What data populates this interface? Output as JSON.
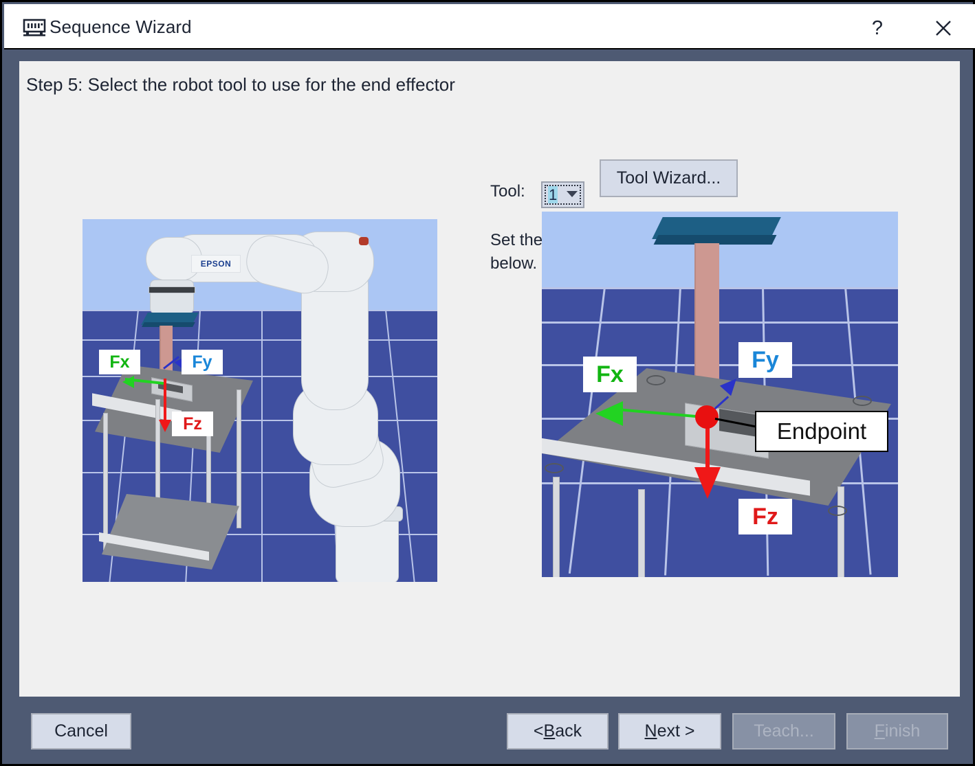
{
  "window": {
    "title": "Sequence Wizard",
    "icon": "chip-icon",
    "help_label": "?",
    "close_label": "✕",
    "frame_color": "#4e5a73",
    "panel_color": "#f0f0f0"
  },
  "content": {
    "step_title": "Step 5: Select the robot tool to use for the end effector",
    "tool_label": "Tool:",
    "tool_value": "1",
    "tool_wizard_button": "Tool Wizard...",
    "description": "Set the endpoint of the workpiece as a tool, as shown below."
  },
  "figures": {
    "left": {
      "name": "robot-arm-overview",
      "brand": "EPSON",
      "labels": [
        {
          "text": "Fx",
          "color": "#12b512"
        },
        {
          "text": "Fy",
          "color": "#1a86d8"
        },
        {
          "text": "Fz",
          "color": "#e01919"
        }
      ]
    },
    "right": {
      "name": "endpoint-closeup",
      "labels": [
        {
          "text": "Fx",
          "color": "#12b512"
        },
        {
          "text": "Fy",
          "color": "#1a86d8"
        },
        {
          "text": "Fz",
          "color": "#e01919"
        },
        {
          "text": "Endpoint",
          "color": "#111111"
        }
      ]
    }
  },
  "footer": {
    "cancel": "Cancel",
    "back_prefix": "< ",
    "back_accel": "B",
    "back_rest": "ack",
    "next_accel": "N",
    "next_rest": "ext >",
    "teach": "Teach...",
    "finish_accel": "F",
    "finish_rest": "inish"
  }
}
